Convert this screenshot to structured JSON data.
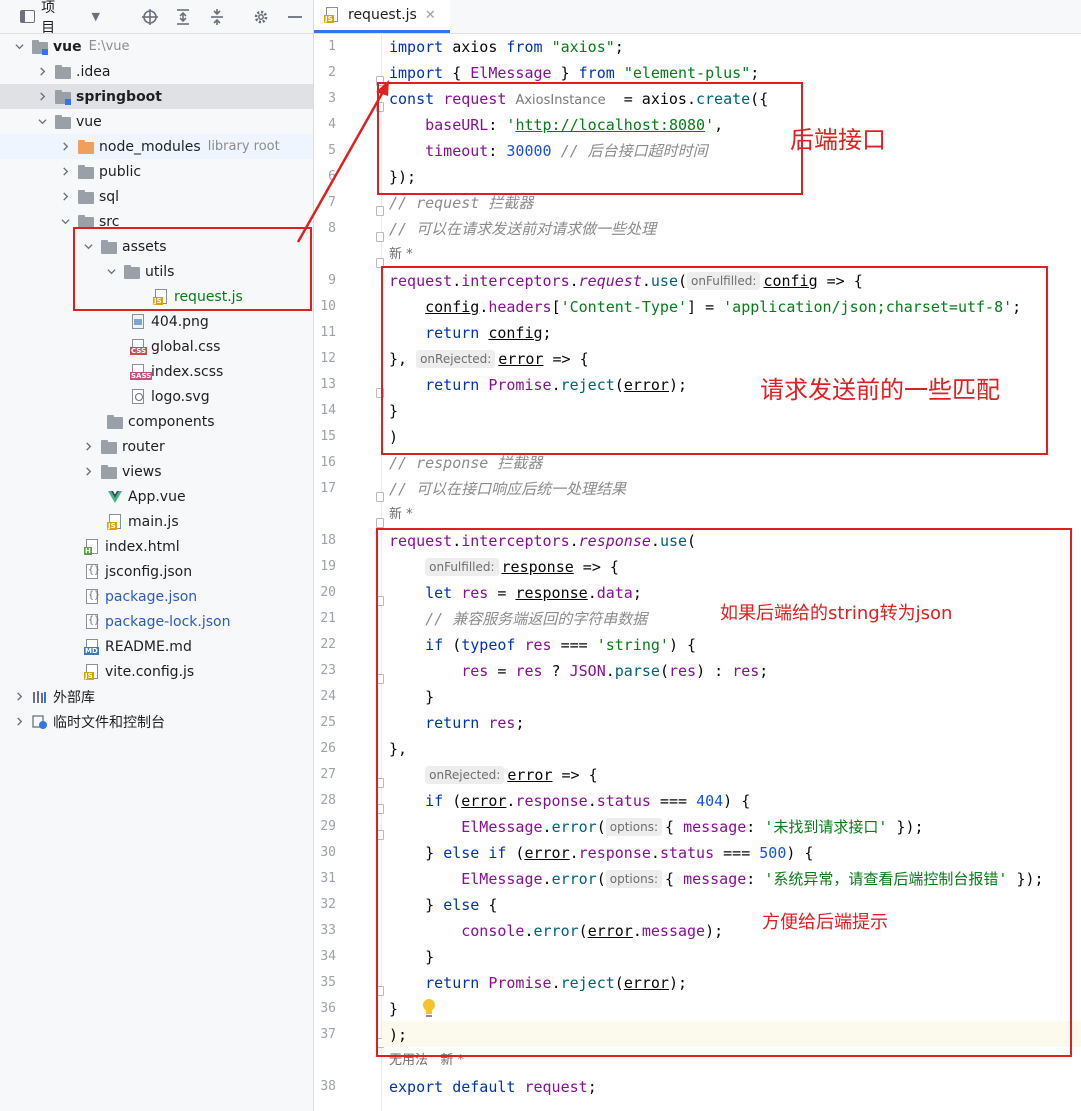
{
  "project_panel": {
    "title": "项目",
    "tree": [
      {
        "label": "vue",
        "path": "E:\\vue"
      },
      {
        "label": ".idea"
      },
      {
        "label": "springboot"
      },
      {
        "label": "vue"
      },
      {
        "label": "node_modules",
        "hint": "library root"
      },
      {
        "label": "public"
      },
      {
        "label": "sql"
      },
      {
        "label": "src"
      },
      {
        "label": "assets"
      },
      {
        "label": "utils"
      },
      {
        "label": "request.js"
      },
      {
        "label": "404.png"
      },
      {
        "label": "global.css"
      },
      {
        "label": "index.scss"
      },
      {
        "label": "logo.svg"
      },
      {
        "label": "components"
      },
      {
        "label": "router"
      },
      {
        "label": "views"
      },
      {
        "label": "App.vue"
      },
      {
        "label": "main.js"
      },
      {
        "label": "index.html"
      },
      {
        "label": "jsconfig.json"
      },
      {
        "label": "package.json"
      },
      {
        "label": "package-lock.json"
      },
      {
        "label": "README.md"
      },
      {
        "label": "vite.config.js"
      },
      {
        "label": "外部库"
      },
      {
        "label": "临时文件和控制台"
      }
    ]
  },
  "editor": {
    "tab_label": "request.js",
    "line_numbers": [
      "1",
      "2",
      "3",
      "4",
      "5",
      "6",
      "7",
      "8",
      "9",
      "10",
      "11",
      "12",
      "13",
      "14",
      "15",
      "16",
      "17",
      "18",
      "19",
      "20",
      "21",
      "22",
      "23",
      "24",
      "25",
      "26",
      "27",
      "28",
      "29",
      "30",
      "31",
      "32",
      "33",
      "34",
      "35",
      "36",
      "37",
      "38"
    ],
    "meta": {
      "new1": "新 *",
      "new2": "新 *",
      "unused": "无用法",
      "new3": "新 *"
    },
    "inlay": {
      "axios_instance": "AxiosInstance",
      "on_fulfilled": "onFulfilled:",
      "on_rejected": "onRejected:",
      "options": "options:"
    },
    "strings": {
      "axios": "\"axios\"",
      "element_plus": "\"element-plus\"",
      "base_url": "'http://localhost:8080'",
      "timeout": "30000",
      "timeout_comment": "// 后台接口超时时间",
      "comment_req1": "// request 拦截器",
      "comment_req2": "// 可以在请求发送前对请求做一些处理",
      "content_type_key": "'Content-Type'",
      "content_type_val": "'application/json;charset=utf-8'",
      "comment_resp1": "// response 拦截器",
      "comment_resp2": "// 可以在接口响应后统一处理结果",
      "comment_compat": "// 兼容服务端返回的字符串数据",
      "string_lit": "'string'",
      "status_404": "404",
      "status_500": "500",
      "msg_404": "'未找到请求接口'",
      "msg_500": "'系统异常，请查看后端控制台报错'"
    }
  },
  "annotations": {
    "backend_api": "后端接口",
    "request_match": "请求发送前的一些匹配",
    "string_to_json": "如果后端给的string转为json",
    "backend_hint": "方便给后端提示"
  },
  "colors": {
    "annotation": "#e02020",
    "keyword": "#0033b3",
    "string": "#067d17",
    "number": "#1750eb",
    "property": "#871094",
    "function": "#00627a",
    "comment": "#8c8c8c"
  }
}
